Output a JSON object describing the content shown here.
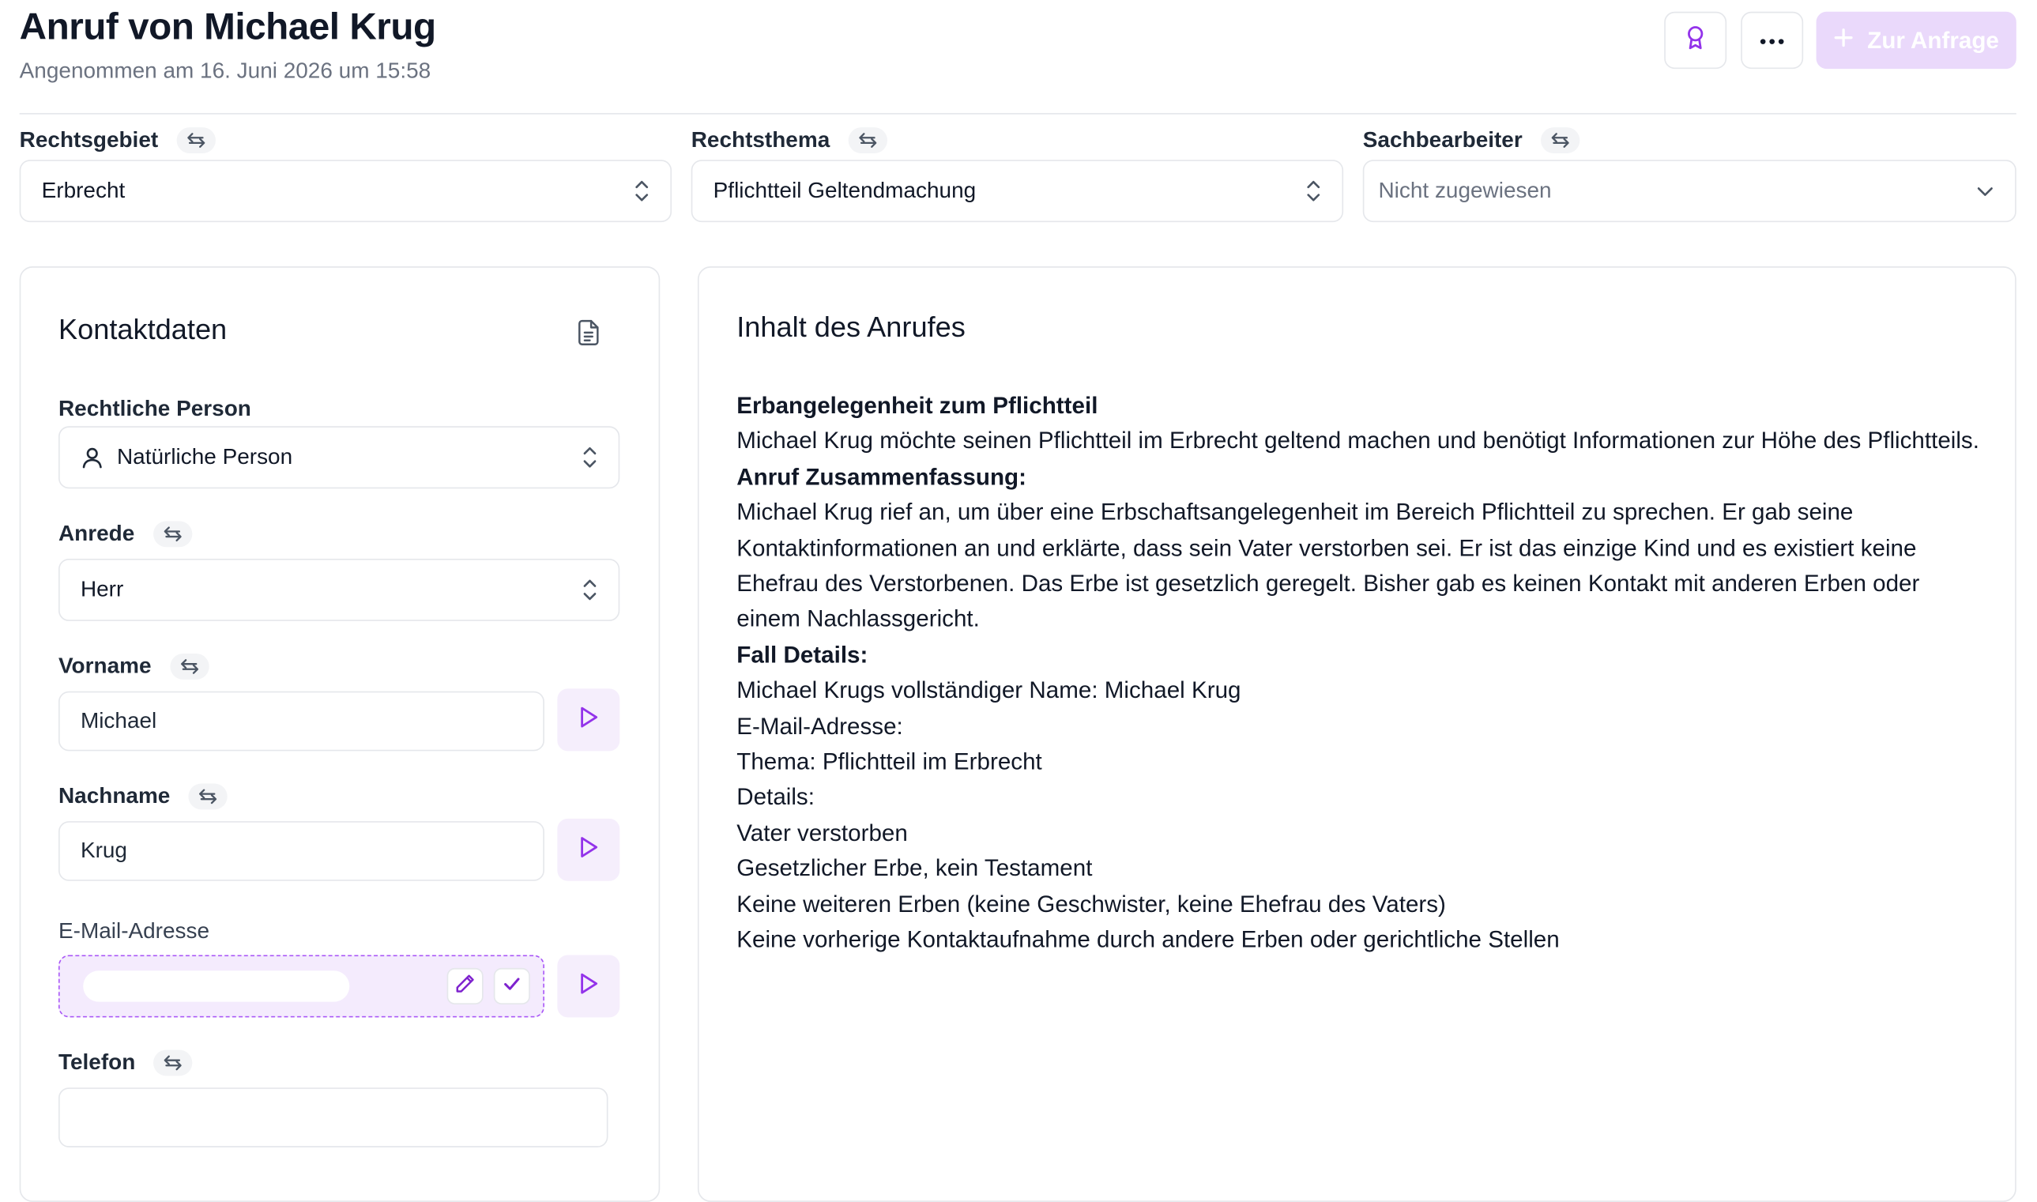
{
  "header": {
    "title": "Anruf von Michael Krug",
    "subtitle": "Angenommen am 16. Juni 2026 um 15:58",
    "award_icon": "award-icon",
    "more_icon": "more-horizontal-icon",
    "primary_button_label": "Zur Anfrage",
    "primary_color": "#ead9fb"
  },
  "fields": {
    "rechtsgebiet": {
      "label": "Rechtsgebiet",
      "value": "Erbrecht"
    },
    "rechtsthema": {
      "label": "Rechtsthema",
      "value": "Pflichtteil Geltendmachung"
    },
    "sachbearbeiter": {
      "label": "Sachbearbeiter",
      "value": "Nicht zugewiesen"
    }
  },
  "kontakt": {
    "title": "Kontaktdaten",
    "rechtliche_person": {
      "label": "Rechtliche Person",
      "value": "Natürliche Person"
    },
    "anrede": {
      "label": "Anrede",
      "value": "Herr"
    },
    "vorname": {
      "label": "Vorname",
      "value": "Michael"
    },
    "nachname": {
      "label": "Nachname",
      "value": "Krug"
    },
    "email": {
      "label": "E-Mail-Adresse",
      "value": ""
    },
    "telefon": {
      "label": "Telefon",
      "value": ""
    }
  },
  "inhalt": {
    "title": "Inhalt des Anrufes",
    "lines": [
      {
        "text": "Erbangelegenheit zum Pflichtteil",
        "bold": true
      },
      {
        "text": "Michael Krug möchte seinen Pflichtteil im Erbrecht geltend machen und benötigt Informationen zur Höhe des Pflichtteils.",
        "bold": false
      },
      {
        "text": "Anruf Zusammenfassung:",
        "bold": true
      },
      {
        "text": "Michael Krug rief an, um über eine Erbschaftsangelegenheit im Bereich Pflichtteil zu sprechen. Er gab seine Kontaktinformationen an und erklärte, dass sein Vater verstorben sei. Er ist das einzige Kind und es existiert keine Ehefrau des Verstorbenen. Das Erbe ist gesetzlich geregelt. Bisher gab es keinen Kontakt mit anderen Erben oder einem Nachlassgericht.",
        "bold": false
      },
      {
        "text": "Fall Details:",
        "bold": true
      },
      {
        "text": "Michael Krugs vollständiger Name: Michael Krug",
        "bold": false
      },
      {
        "text": "E-Mail-Adresse:",
        "bold": false
      },
      {
        "text": "Thema: Pflichtteil im Erbrecht",
        "bold": false
      },
      {
        "text": "Details:",
        "bold": false
      },
      {
        "text": "Vater verstorben",
        "bold": false
      },
      {
        "text": "Gesetzlicher Erbe, kein Testament",
        "bold": false
      },
      {
        "text": "Keine weiteren Erben (keine Geschwister, keine Ehefrau des Vaters)",
        "bold": false
      },
      {
        "text": "Keine vorherige Kontaktaufnahme durch andere Erben oder gerichtliche Stellen",
        "bold": false
      }
    ]
  }
}
